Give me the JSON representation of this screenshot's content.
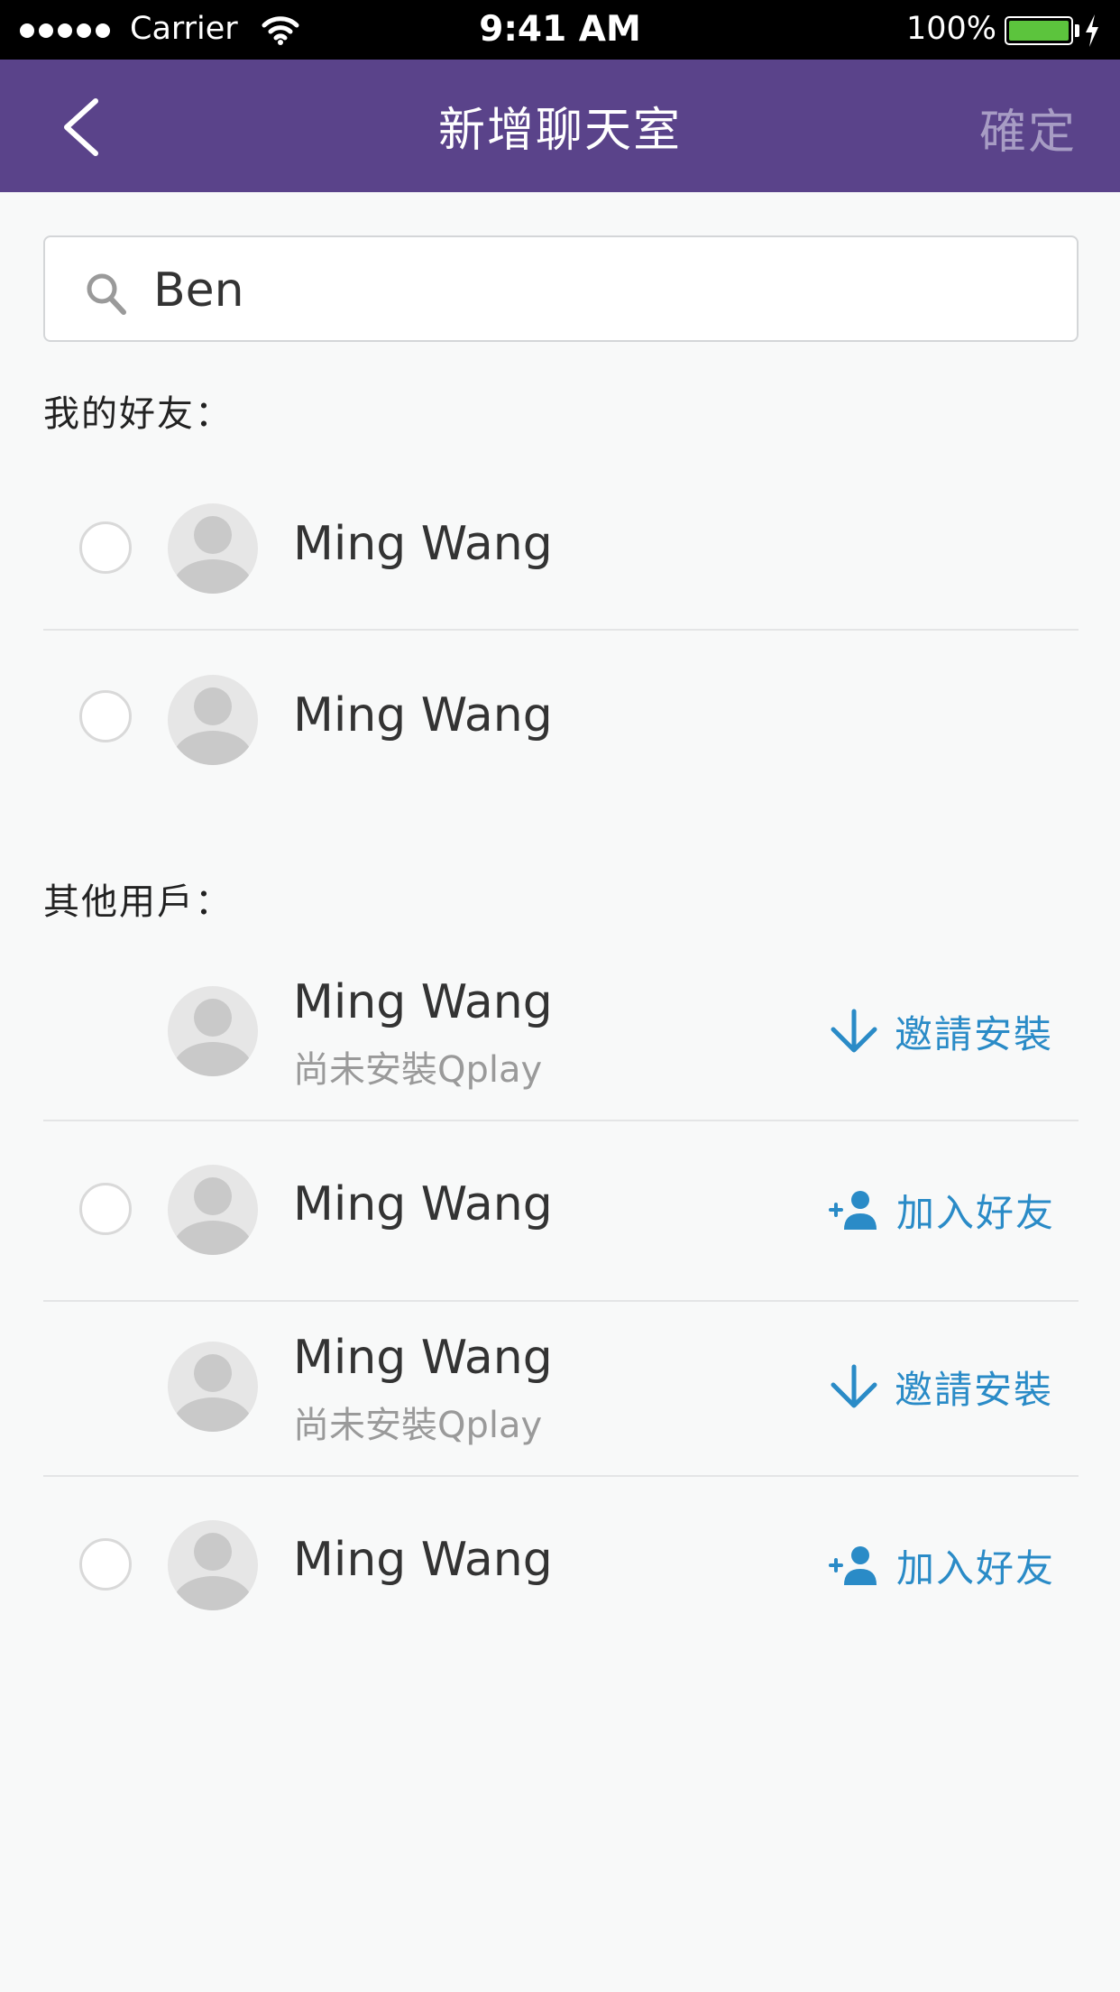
{
  "status_bar": {
    "carrier": "Carrier",
    "time": "9:41 AM",
    "battery": "100%"
  },
  "nav": {
    "title": "新增聊天室",
    "confirm_label": "確定"
  },
  "search": {
    "value": "Ben"
  },
  "friends": {
    "label": "我的好友：",
    "items": [
      {
        "name": "Ming Wang"
      },
      {
        "name": "Ming Wang"
      }
    ]
  },
  "others": {
    "label": "其他用戶：",
    "items": [
      {
        "name": "Ming Wang",
        "sub": "尚未安裝Qplay",
        "action": "邀請安裝",
        "action_icon": "download-arrow-icon"
      },
      {
        "name": "Ming Wang",
        "action": "加入好友",
        "action_icon": "add-person-icon"
      },
      {
        "name": "Ming Wang",
        "sub": "尚未安裝Qplay",
        "action": "邀請安裝",
        "action_icon": "download-arrow-icon"
      },
      {
        "name": "Ming Wang",
        "action": "加入好友",
        "action_icon": "add-person-icon"
      }
    ]
  },
  "colors": {
    "nav_bg": "#5a438a",
    "accent": "#2a8bc7",
    "confirm_disabled": "#a79cc4"
  }
}
